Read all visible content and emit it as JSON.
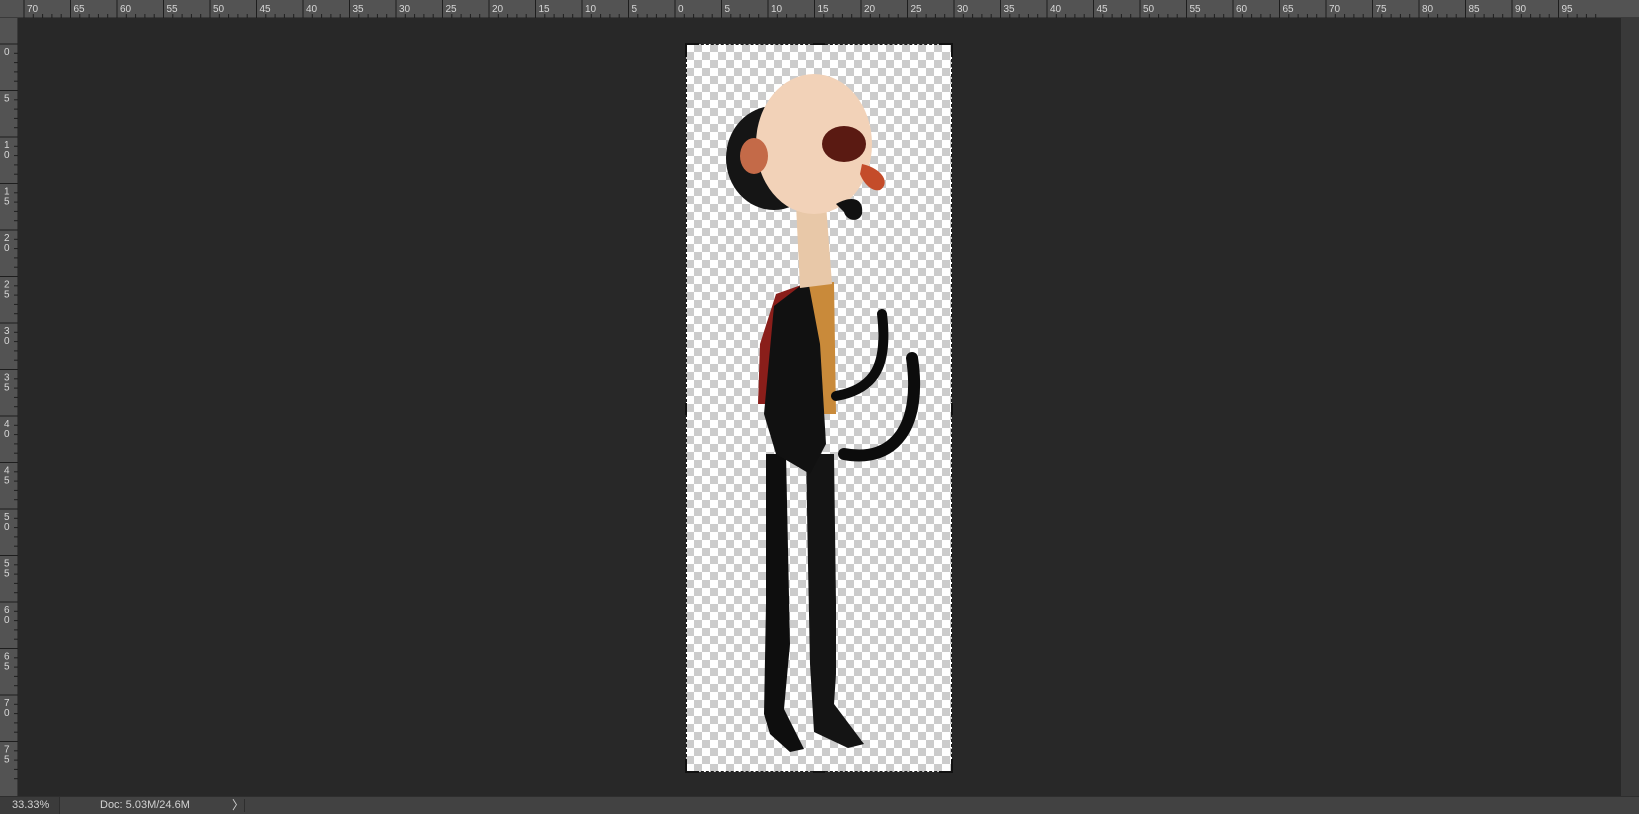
{
  "ruler_h": {
    "labels": [
      "70",
      "65",
      "60",
      "55",
      "50",
      "45",
      "40",
      "35",
      "30",
      "25",
      "20",
      "15",
      "10",
      "5",
      "0",
      "5",
      "10",
      "15",
      "20",
      "25",
      "30",
      "35",
      "40",
      "45",
      "50",
      "55",
      "60",
      "65",
      "70",
      "75",
      "80",
      "85",
      "90",
      "95"
    ]
  },
  "ruler_v": {
    "labels": [
      "0",
      "5",
      "10",
      "15",
      "20",
      "25",
      "30",
      "35",
      "40",
      "45",
      "50",
      "55",
      "60",
      "65",
      "70",
      "75"
    ]
  },
  "status": {
    "zoom": "33.33%",
    "doc_info": "Doc: 5.03M/24.6M",
    "arrow": "〉"
  },
  "colors": {
    "canvas_bg": "#282828",
    "ruler_bg": "#535353",
    "statusbar_bg": "#424242"
  }
}
